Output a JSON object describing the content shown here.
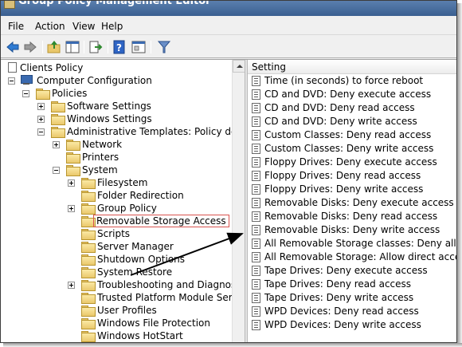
{
  "window": {
    "title": "Group Policy Management Editor"
  },
  "menu": [
    "File",
    "Action",
    "View",
    "Help"
  ],
  "toolbar": {
    "icons": [
      "back-arrow-icon",
      "forward-arrow-icon",
      "up-folder-icon",
      "show-hide-tree-icon",
      "export-list-icon",
      "help-icon",
      "properties-icon",
      "filter-icon"
    ]
  },
  "tree": {
    "root": "Clients Policy",
    "computer_configuration": "Computer Configuration",
    "policies": "Policies",
    "software_settings": "Software Settings",
    "windows_settings": "Windows Settings",
    "administrative_templates": "Administrative Templates: Policy definitions",
    "network": "Network",
    "printers": "Printers",
    "system": "System",
    "system_children": [
      "Filesystem",
      "Folder Redirection",
      "Group Policy",
      "Removable Storage Access",
      "Scripts",
      "Server Manager",
      "Shutdown Options",
      "System Restore",
      "Troubleshooting and Diagnostics",
      "Trusted Platform Module Services",
      "User Profiles",
      "Windows File Protection",
      "Windows HotStart"
    ]
  },
  "list": {
    "column_header": "Setting",
    "rows": [
      "Time (in seconds) to force reboot",
      "CD and DVD: Deny execute access",
      "CD and DVD: Deny read access",
      "CD and DVD: Deny write access",
      "Custom Classes: Deny read access",
      "Custom Classes: Deny write access",
      "Floppy Drives: Deny execute access",
      "Floppy Drives: Deny read access",
      "Floppy Drives: Deny write access",
      "Removable Disks: Deny execute access",
      "Removable Disks: Deny read access",
      "Removable Disks: Deny write access",
      "All Removable Storage classes: Deny all access",
      "All Removable Storage: Allow direct access in remo",
      "Tape Drives: Deny execute access",
      "Tape Drives: Deny read access",
      "Tape Drives: Deny write access",
      "WPD Devices: Deny read access",
      "WPD Devices: Deny write access"
    ]
  },
  "colors": {
    "titlebar": "#4a6f9e",
    "selection_outline": "#d9534f",
    "folder": "#eac86c"
  }
}
